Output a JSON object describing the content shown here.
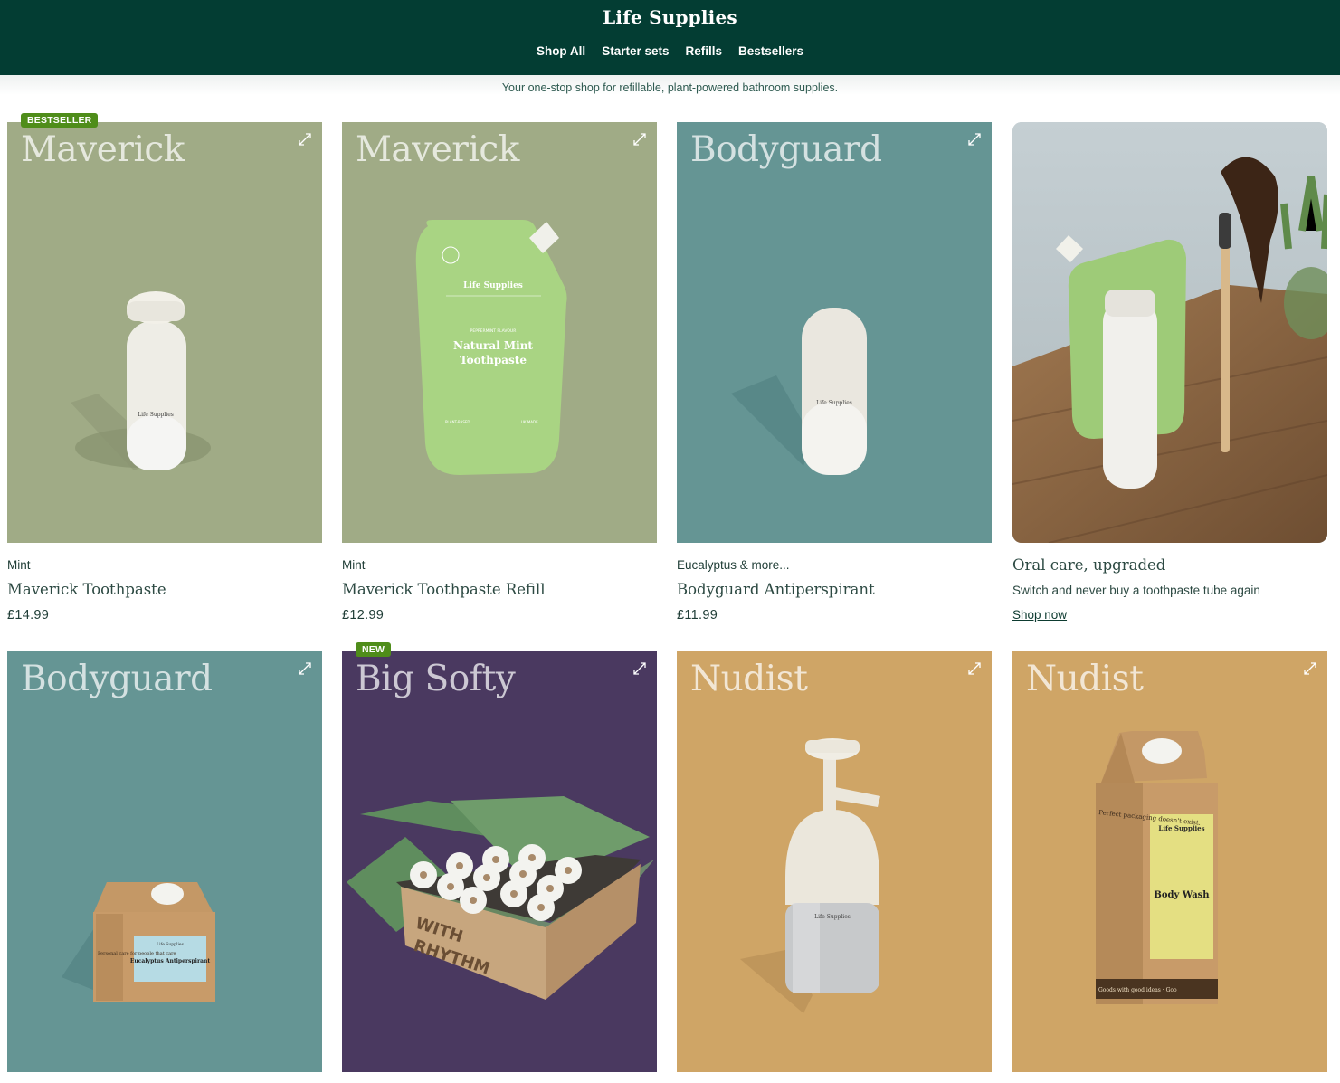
{
  "header": {
    "brand": "Life Supplies",
    "nav": [
      "Shop All",
      "Starter sets",
      "Refills",
      "Bestsellers"
    ]
  },
  "tagline": "Your one-stop shop for refillable, plant-powered bathroom supplies.",
  "colors": {
    "header_bg": "#033d33",
    "sage": "#a0ab86",
    "teal": "#659594",
    "purple": "#4a3960",
    "ochre": "#cfa566",
    "badge_green": "#4f8d1a"
  },
  "products_row1": [
    {
      "brand": "Maverick",
      "badge": "BESTSELLER",
      "variant": "Mint",
      "title": "Maverick Toothpaste",
      "price": "£14.99"
    },
    {
      "brand": "Maverick",
      "variant": "Mint",
      "title": "Maverick Toothpaste Refill",
      "price": "£12.99",
      "pouch": {
        "label": "Life Supplies",
        "flavour": "PEPPERMINT FLAVOUR",
        "name_line1": "Natural Mint",
        "name_line2": "Toothpaste",
        "left": "PLANT-BASED",
        "right": "UK MADE"
      }
    },
    {
      "brand": "Bodyguard",
      "variant": "Eucalyptus & more...",
      "title": "Bodyguard Antiperspirant",
      "price": "£11.99",
      "bottle_label": "Life Supplies"
    }
  ],
  "promo": {
    "title": "Oral care, upgraded",
    "subtitle": "Switch and never buy a toothpaste tube again",
    "link": "Shop now"
  },
  "products_row2": [
    {
      "brand": "Bodyguard",
      "carton": {
        "label": "Life Supplies",
        "name": "Eucalyptus Antiperspirant",
        "side": "Personal care for people that care"
      }
    },
    {
      "brand": "Big Softy",
      "badge": "NEW",
      "box_text_1": "WITH",
      "box_text_2": "RHYTHM"
    },
    {
      "brand": "Nudist",
      "bottle_label": "Life Supplies"
    },
    {
      "brand": "Nudist",
      "carton": {
        "side": "Perfect packaging doesn't exist.",
        "label": "Life Supplies",
        "name": "Body Wash",
        "strip": "Goods with good ideas · Goo"
      }
    }
  ],
  "icons": {
    "expand": "expand-arrows-icon"
  }
}
